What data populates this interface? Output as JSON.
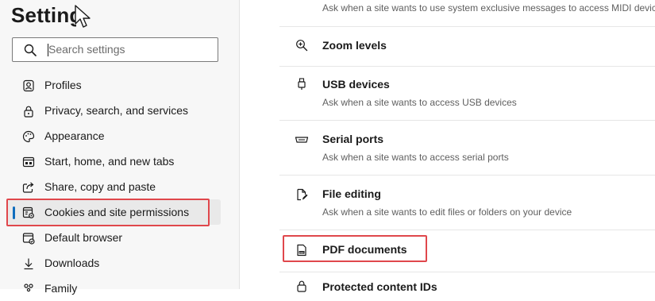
{
  "header": {
    "title": "Settings"
  },
  "search": {
    "placeholder": "Search settings",
    "icon": "search-icon"
  },
  "sidebar": {
    "items": [
      {
        "label": "Profiles",
        "icon": "profile-icon"
      },
      {
        "label": "Privacy, search, and services",
        "icon": "lock-icon"
      },
      {
        "label": "Appearance",
        "icon": "palette-icon"
      },
      {
        "label": "Start, home, and new tabs",
        "icon": "start-page-icon"
      },
      {
        "label": "Share, copy and paste",
        "icon": "share-icon"
      },
      {
        "label": "Cookies and site permissions",
        "icon": "cookies-permissions-icon",
        "selected": true
      },
      {
        "label": "Default browser",
        "icon": "default-browser-icon"
      },
      {
        "label": "Downloads",
        "icon": "download-icon"
      },
      {
        "label": "Family",
        "icon": "family-icon"
      }
    ]
  },
  "content": {
    "midi_description": "Ask when a site wants to use system exclusive messages to access MIDI devices",
    "rows": [
      {
        "title": "Zoom levels",
        "description": "",
        "icon": "zoom-icon"
      },
      {
        "title": "USB devices",
        "description": "Ask when a site wants to access USB devices",
        "icon": "usb-icon"
      },
      {
        "title": "Serial ports",
        "description": "Ask when a site wants to access serial ports",
        "icon": "serial-port-icon"
      },
      {
        "title": "File editing",
        "description": "Ask when a site wants to edit files or folders on your device",
        "icon": "file-edit-icon"
      },
      {
        "title": "PDF documents",
        "description": "",
        "icon": "pdf-icon"
      },
      {
        "title": "Protected content IDs",
        "description": "",
        "icon": "protected-content-icon"
      }
    ]
  },
  "colors": {
    "accent": "#0f6cbd",
    "highlight_box": "#e0474c",
    "sidebar_bg": "#f7f7f7"
  }
}
